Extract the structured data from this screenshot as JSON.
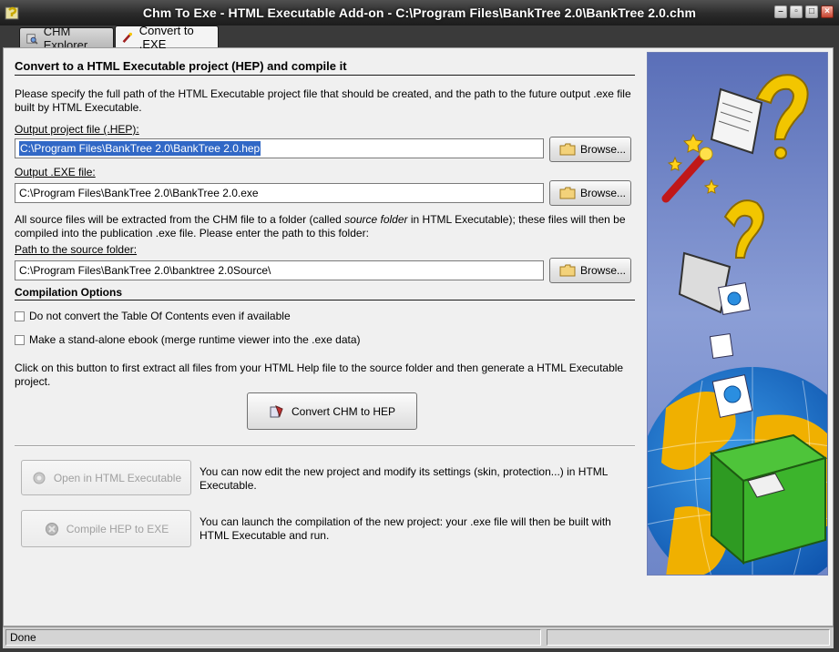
{
  "window": {
    "title": "Chm To Exe - HTML Executable Add-on - C:\\Program Files\\BankTree 2.0\\BankTree 2.0.chm",
    "controls": [
      "minimize",
      "restore",
      "maximize",
      "close"
    ]
  },
  "tabs": [
    {
      "label": "CHM Explorer",
      "icon": "chm-explorer-icon",
      "active": false
    },
    {
      "label": "Convert to .EXE",
      "icon": "magic-wand-icon",
      "active": true
    }
  ],
  "main": {
    "heading": "Convert to a HTML Executable project (HEP) and compile it",
    "intro_line1": "Please specify the full path of the HTML Executable project file that should be created, and the path to the future output .exe file",
    "intro_line2": "built by HTML Executable.",
    "hep_label": "Output project file (.HEP):",
    "hep_value": "C:\\Program Files\\BankTree 2.0\\BankTree 2.0.hep",
    "exe_label": "Output .EXE file:",
    "exe_value": "C:\\Program Files\\BankTree 2.0\\BankTree 2.0.exe",
    "source_text1_a": "All source files will be extracted from the CHM file to a folder (called ",
    "source_text1_em": "source folder",
    "source_text1_b": " in HTML Executable); these files will then be",
    "source_text2": "compiled into the publication .exe file. Please enter the path to this folder:",
    "source_label": "Path to the source folder:",
    "source_value": "C:\\Program Files\\BankTree 2.0\\banktree 2.0Source\\",
    "browse_label": "Browse...",
    "options_heading": "Compilation Options",
    "option1": "Do not convert the Table Of Contents even if available",
    "option2": "Make a stand-alone ebook (merge runtime viewer into the .exe data)",
    "convert_text1": "Click on this button to first extract all files from your HTML Help file to the source folder and then generate a HTML Executable",
    "convert_text2": "project.",
    "convert_button": "Convert CHM to HEP",
    "open_button": "Open in HTML Executable",
    "open_desc1": "You can now edit the new project and modify its settings (skin, protection...) in HTML",
    "open_desc2": "Executable.",
    "compile_button": "Compile HEP to EXE",
    "compile_desc1": "You can launch the compilation of the new project: your .exe file will then be built with",
    "compile_desc2": "HTML Executable and run."
  },
  "status": {
    "text": "Done"
  },
  "colors": {
    "selection": "#3168c6",
    "panel": "#f0f0f0",
    "titlebar": "#2a2a2a"
  }
}
